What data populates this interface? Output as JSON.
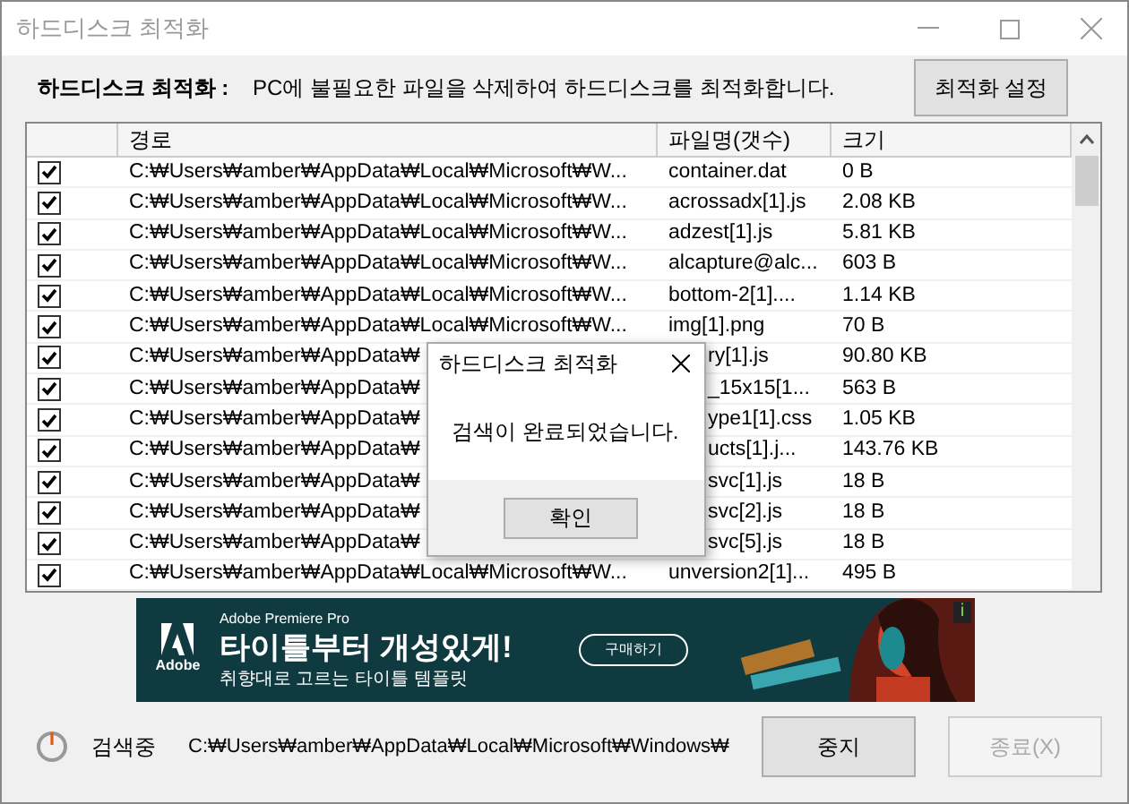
{
  "window": {
    "title": "하드디스크 최적화"
  },
  "header": {
    "label": "하드디스크 최적화 :",
    "description": "PC에 불필요한 파일을 삭제하여 하드디스크를 최적화합니다.",
    "settings_button": "최적화 설정"
  },
  "table": {
    "columns": [
      "경로",
      "파일명(갯수)",
      "크기"
    ],
    "rows": [
      {
        "checked": true,
        "path": "C:₩Users₩amber₩AppData₩Local₩Microsoft₩W...",
        "name": "container.dat",
        "size": "0 B",
        "partly_hidden": false
      },
      {
        "checked": true,
        "path": "C:₩Users₩amber₩AppData₩Local₩Microsoft₩W...",
        "name": "acrossadx[1].js",
        "size": "2.08 KB",
        "partly_hidden": false
      },
      {
        "checked": true,
        "path": "C:₩Users₩amber₩AppData₩Local₩Microsoft₩W...",
        "name": "adzest[1].js",
        "size": "5.81 KB",
        "partly_hidden": false
      },
      {
        "checked": true,
        "path": "C:₩Users₩amber₩AppData₩Local₩Microsoft₩W...",
        "name": "alcapture@alc...",
        "size": "603 B",
        "partly_hidden": false
      },
      {
        "checked": true,
        "path": "C:₩Users₩amber₩AppData₩Local₩Microsoft₩W...",
        "name": "bottom-2[1]....",
        "size": "1.14 KB",
        "partly_hidden": false
      },
      {
        "checked": true,
        "path": "C:₩Users₩amber₩AppData₩Local₩Microsoft₩W...",
        "name": "img[1].png",
        "size": "70 B",
        "partly_hidden": false
      },
      {
        "checked": true,
        "path": "C:₩Users₩amber₩AppData₩",
        "name": "ry[1].js",
        "size": "90.80 KB",
        "partly_hidden": true
      },
      {
        "checked": true,
        "path": "C:₩Users₩amber₩AppData₩",
        "name": "_15x15[1...",
        "size": "563 B",
        "partly_hidden": true
      },
      {
        "checked": true,
        "path": "C:₩Users₩amber₩AppData₩",
        "name": "ype1[1].css",
        "size": "1.05 KB",
        "partly_hidden": true
      },
      {
        "checked": true,
        "path": "C:₩Users₩amber₩AppData₩",
        "name": "ucts[1].j...",
        "size": "143.76 KB",
        "partly_hidden": true
      },
      {
        "checked": true,
        "path": "C:₩Users₩amber₩AppData₩",
        "name": "svc[1].js",
        "size": "18 B",
        "partly_hidden": true
      },
      {
        "checked": true,
        "path": "C:₩Users₩amber₩AppData₩",
        "name": "svc[2].js",
        "size": "18 B",
        "partly_hidden": true
      },
      {
        "checked": true,
        "path": "C:₩Users₩amber₩AppData₩",
        "name": "svc[5].js",
        "size": "18 B",
        "partly_hidden": true
      },
      {
        "checked": true,
        "path": "C:₩Users₩amber₩AppData₩Local₩Microsoft₩W...",
        "name": "unversion2[1]...",
        "size": "495 B",
        "partly_hidden": false
      }
    ]
  },
  "banner": {
    "brand": "Adobe",
    "product": "Adobe Premiere Pro",
    "headline": "타이틀부터 개성있게!",
    "subline": "취향대로 고르는 타이틀 템플릿",
    "button": "구매하기",
    "info": "i"
  },
  "status": {
    "label": "검색중",
    "path": "C:₩Users₩amber₩AppData₩Local₩Microsoft₩Windows₩"
  },
  "buttons": [
    {
      "label": "중지",
      "disabled": false
    },
    {
      "label": "종료(X)",
      "disabled": true
    }
  ],
  "dialog": {
    "title": "하드디스크 최적화",
    "message": "검색이 완료되었습니다.",
    "button": "확인"
  }
}
